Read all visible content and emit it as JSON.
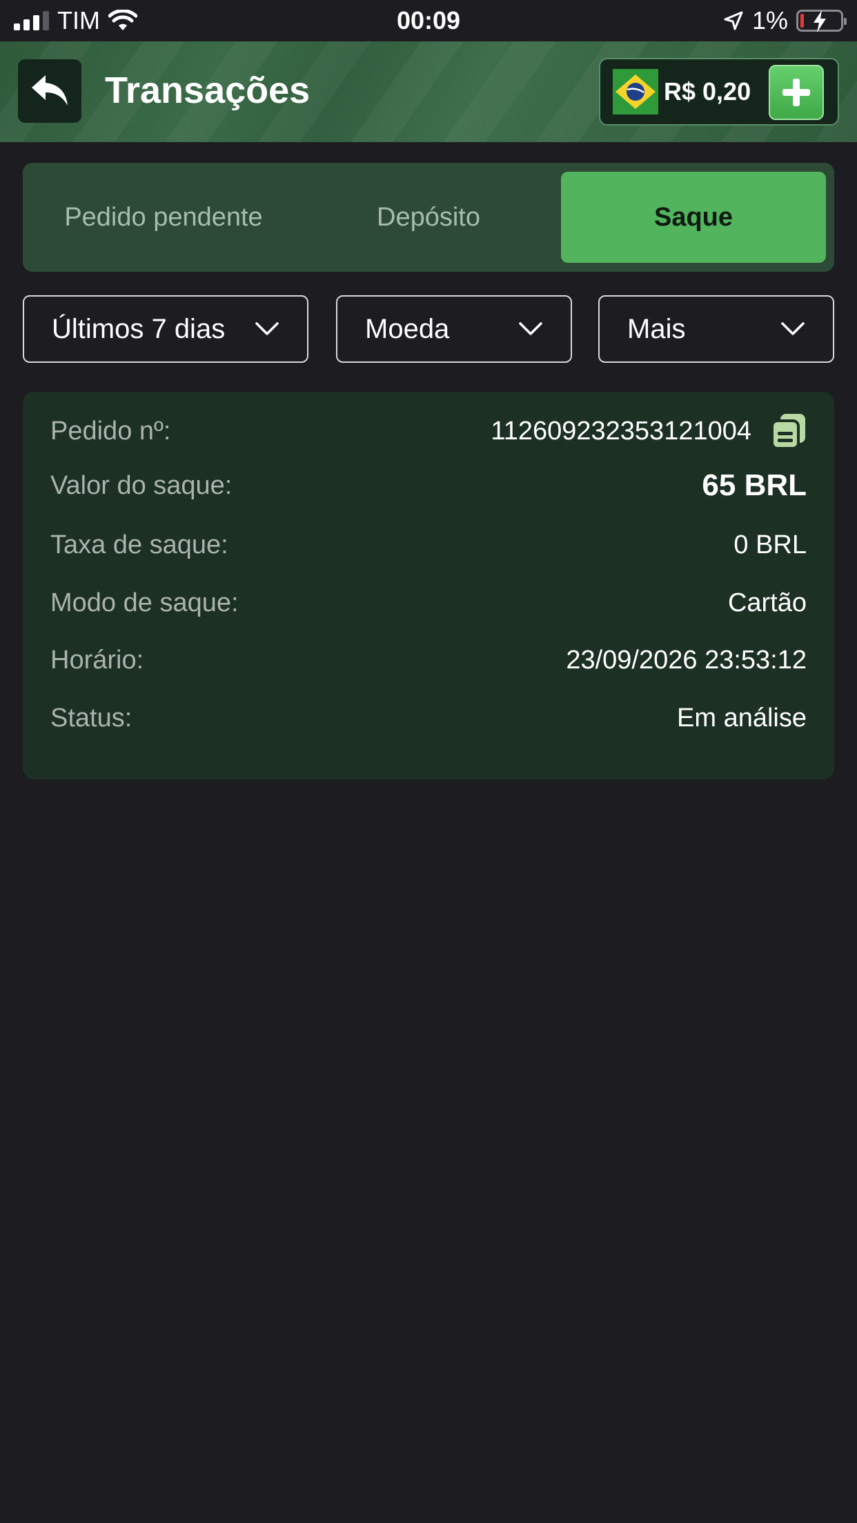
{
  "status_bar": {
    "carrier": "TIM",
    "time": "00:09",
    "battery": "1%"
  },
  "header": {
    "title": "Transações",
    "balance": "R$ 0,20"
  },
  "tabs": [
    {
      "label": "Pedido pendente",
      "active": false
    },
    {
      "label": "Depósito",
      "active": false
    },
    {
      "label": "Saque",
      "active": true
    }
  ],
  "filters": {
    "period": "Últimos 7 dias",
    "currency": "Moeda",
    "more": "Mais"
  },
  "transaction": {
    "order_label": "Pedido nº:",
    "order_value": "112609232353121004",
    "amount_label": "Valor do saque:",
    "amount_value": "65 BRL",
    "fee_label": "Taxa de saque:",
    "fee_value": "0 BRL",
    "mode_label": "Modo de saque:",
    "mode_value": "Cartão",
    "time_label": "Horário:",
    "time_value": "23/09/2026 23:53:12",
    "status_label": "Status:",
    "status_value": "Em análise"
  },
  "colors": {
    "background": "#1c1c21",
    "header_green": "#3b6b48",
    "active_tab": "#52b45c",
    "card_bg": "#1c3023"
  }
}
